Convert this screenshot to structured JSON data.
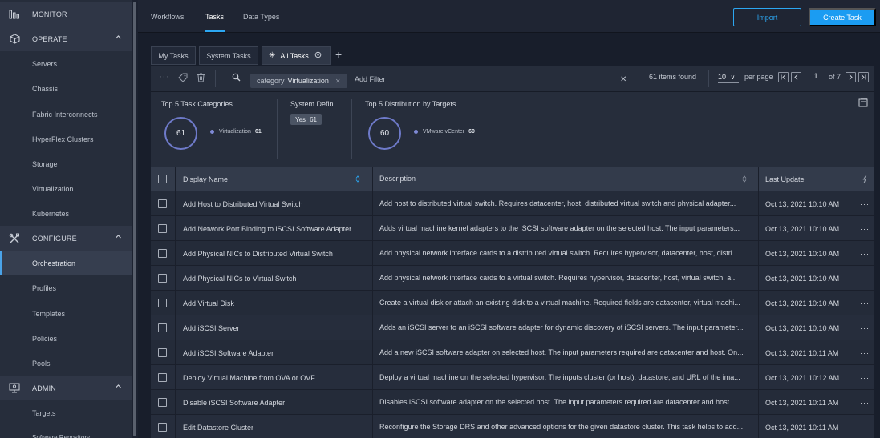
{
  "sidebar": {
    "sections": [
      {
        "label": "MONITOR",
        "icon": "bar-chart-icon",
        "chevron": false
      },
      {
        "label": "OPERATE",
        "icon": "cube-icon",
        "chevron": true
      },
      {
        "label": "CONFIGURE",
        "icon": "tools-icon",
        "chevron": true
      },
      {
        "label": "ADMIN",
        "icon": "admin-icon",
        "chevron": true
      }
    ],
    "operate_items": [
      "Servers",
      "Chassis",
      "Fabric Interconnects",
      "HyperFlex Clusters",
      "Storage",
      "Virtualization",
      "Kubernetes"
    ],
    "configure_items": [
      "Orchestration",
      "Profiles",
      "Templates",
      "Policies",
      "Pools"
    ],
    "admin_items": [
      "Targets",
      "Software Repository"
    ],
    "active_item": "Orchestration"
  },
  "header": {
    "tabs": [
      "Workflows",
      "Tasks",
      "Data Types"
    ],
    "active_tab": "Tasks",
    "import_label": "Import",
    "create_label": "Create Task"
  },
  "task_tabs": {
    "tabs": [
      "My Tasks",
      "System Tasks",
      "All Tasks"
    ],
    "active": "All Tasks"
  },
  "toolbar": {
    "filter_key": "category",
    "filter_value": "Virtualization",
    "add_filter": "Add Filter",
    "items_found": "61 items found",
    "per_page_value": "10",
    "per_page_label": "per page",
    "page": "1",
    "of_pages": "of 7"
  },
  "summary": {
    "categories": {
      "title": "Top 5 Task Categories",
      "total": "61",
      "label": "Virtualization",
      "value": "61"
    },
    "system_defined": {
      "title": "System Defin...",
      "badge_label": "Yes",
      "badge_value": "61"
    },
    "targets": {
      "title": "Top 5 Distribution by Targets",
      "total": "60",
      "label": "VMware vCenter",
      "value": "60"
    }
  },
  "table": {
    "columns": [
      "Display Name",
      "Description",
      "Last Update"
    ],
    "rows": [
      {
        "name": "Add Host to Distributed Virtual Switch",
        "desc": "Add host to distributed virtual switch. Requires datacenter, host, distributed virtual switch and physical adapter...",
        "date": "Oct 13, 2021 10:10 AM"
      },
      {
        "name": "Add Network Port Binding to iSCSI Software Adapter",
        "desc": "Adds virtual machine kernel adapters to the iSCSI software adapter on the selected host. The input parameters...",
        "date": "Oct 13, 2021 10:10 AM"
      },
      {
        "name": "Add Physical NICs to Distributed Virtual Switch",
        "desc": "Add physical network interface cards to a distributed virtual switch. Requires hypervisor, datacenter, host, distri...",
        "date": "Oct 13, 2021 10:10 AM"
      },
      {
        "name": "Add Physical NICs to Virtual Switch",
        "desc": "Add physical network interface cards to a virtual switch. Requires hypervisor, datacenter, host, virtual switch, a...",
        "date": "Oct 13, 2021 10:10 AM"
      },
      {
        "name": "Add Virtual Disk",
        "desc": "Create a virtual disk or attach an existing disk to a virtual machine. Required fields are datacenter, virtual machi...",
        "date": "Oct 13, 2021 10:10 AM"
      },
      {
        "name": "Add iSCSI Server",
        "desc": "Adds an iSCSI server to an iSCSI software adapter for dynamic discovery of iSCSI servers. The input parameter...",
        "date": "Oct 13, 2021 10:10 AM"
      },
      {
        "name": "Add iSCSI Software Adapter",
        "desc": "Add a new iSCSI software adapter on selected host. The input parameters required are datacenter and host. On...",
        "date": "Oct 13, 2021 10:11 AM"
      },
      {
        "name": "Deploy Virtual Machine from OVA or OVF",
        "desc": "Deploy a virtual machine on the selected hypervisor. The inputs cluster (or host), datastore, and URL of the ima...",
        "date": "Oct 13, 2021 10:12 AM"
      },
      {
        "name": "Disable iSCSI Software Adapter",
        "desc": "Disables iSCSI software adapter on the selected host. The input parameters required are datacenter and host. ...",
        "date": "Oct 13, 2021 10:11 AM"
      },
      {
        "name": "Edit Datastore Cluster",
        "desc": "Reconfigure the Storage DRS and other advanced options for the given datastore cluster. This task helps to add...",
        "date": "Oct 13, 2021 10:11 AM"
      }
    ],
    "more_glyph": "···"
  },
  "colors": {
    "accent": "#1b9cf2",
    "ring": "#6e7ac9",
    "background": "#181e2b"
  }
}
